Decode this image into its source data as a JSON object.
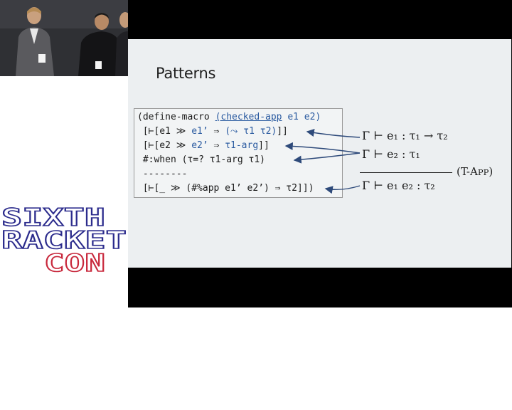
{
  "slide": {
    "title": "Patterns",
    "code": {
      "line1_a": "(define-macro ",
      "line1_b": "(checked-app",
      "line1_c": " e1 e2)",
      "line2_a": " [⊢[e1 ≫ ",
      "line2_b": "e1’",
      "line2_c": " ⇒ ",
      "line2_d": "(⤳ τ1 τ2)",
      "line2_e": "]]",
      "line3_a": " [⊢[e2 ≫ ",
      "line3_b": "e2’",
      "line3_c": " ⇒ ",
      "line3_d": "τ1-arg",
      "line3_e": "]]",
      "line4": " #:when (τ=? τ1-arg τ1)",
      "line5": " --------",
      "line6": " [⊢[_ ≫ (#%app e1’ e2’) ⇒ τ2]])"
    },
    "rule": {
      "premise1": "Γ ⊢ e₁ : τ₁ → τ₂",
      "premise2": "Γ ⊢ e₂ : τ₁",
      "conclusion": "Γ ⊢ e₁ e₂ : τ₂",
      "name_open": "(T-A",
      "name_small": "PP",
      "name_close": ")"
    }
  },
  "logo": {
    "line1": "SIXTH",
    "line2": "RACKET",
    "line3": "CON"
  },
  "colors": {
    "code_blue": "#2a5aa0",
    "arrow": "#2e4a7a",
    "logo_blue": "#2b2b8c",
    "logo_red": "#c8283c"
  }
}
